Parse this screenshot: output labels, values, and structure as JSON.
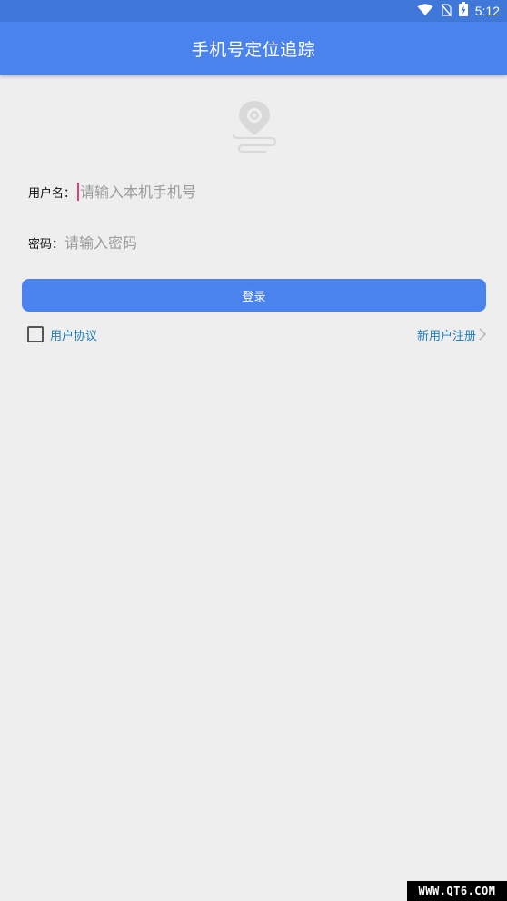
{
  "status_bar": {
    "time": "5:12",
    "icons": [
      "wifi-icon",
      "no-sim-icon",
      "battery-charging-icon"
    ]
  },
  "app_bar": {
    "title": "手机号定位追踪"
  },
  "logo": {
    "icon": "location-pin-icon",
    "color": "#d9d9d9"
  },
  "form": {
    "username_label": "用户名：",
    "username_value": "",
    "username_placeholder": "请输入本机手机号",
    "password_label": "密码：",
    "password_value": "",
    "password_placeholder": "请输入密码"
  },
  "login_button": {
    "label": "登录"
  },
  "agreement": {
    "checked": false,
    "label": "用户协议"
  },
  "register": {
    "label": "新用户注册",
    "icon": "chevron-right-icon"
  },
  "watermark": {
    "text": "WWW.QT6.COM"
  },
  "colors": {
    "primary": "#4a82ee",
    "status_bar": "#3f78d8",
    "link": "#1e7fbd",
    "background": "#eeeeee",
    "caret": "#e0436e"
  }
}
